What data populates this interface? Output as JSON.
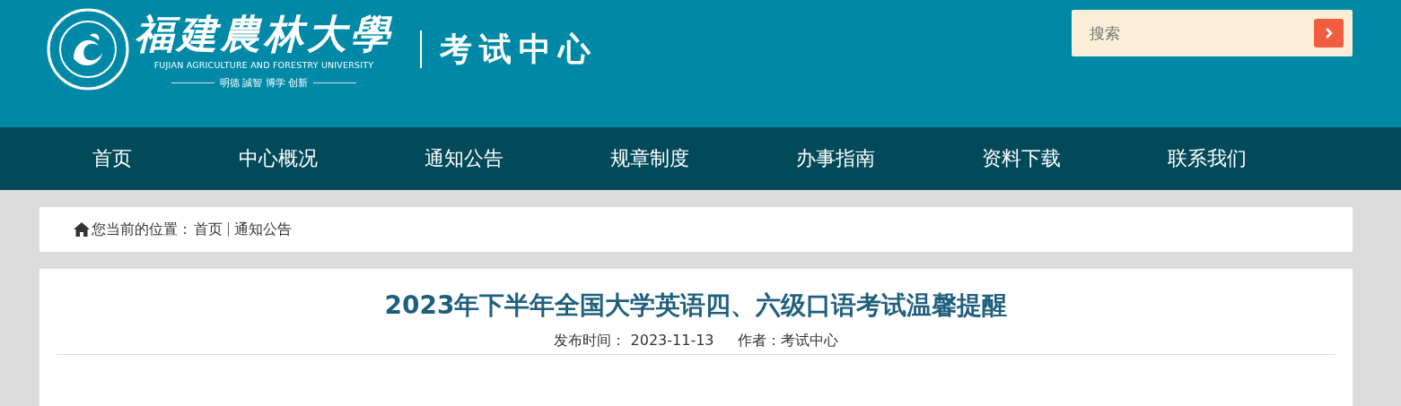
{
  "header": {
    "university_name": "福建農林大學",
    "university_name_en": "FUJIAN AGRICULTURE AND FORESTRY UNIVERSITY",
    "motto": "明德 誠智 博学 创新",
    "site_name": "考试中心"
  },
  "search": {
    "placeholder": "搜索"
  },
  "nav": [
    {
      "label": "首页"
    },
    {
      "label": "中心概况"
    },
    {
      "label": "通知公告"
    },
    {
      "label": "规章制度"
    },
    {
      "label": "办事指南"
    },
    {
      "label": "资料下载"
    },
    {
      "label": "联系我们"
    }
  ],
  "breadcrumb": {
    "prefix": "您当前的位置：",
    "items": [
      "首页",
      "通知公告"
    ]
  },
  "article": {
    "title": "2023年下半年全国大学英语四、六级口语考试温馨提醒",
    "date_label": "发布时间：",
    "date": "2023-11-13",
    "author_label": "作者：",
    "author": "考试中心"
  }
}
